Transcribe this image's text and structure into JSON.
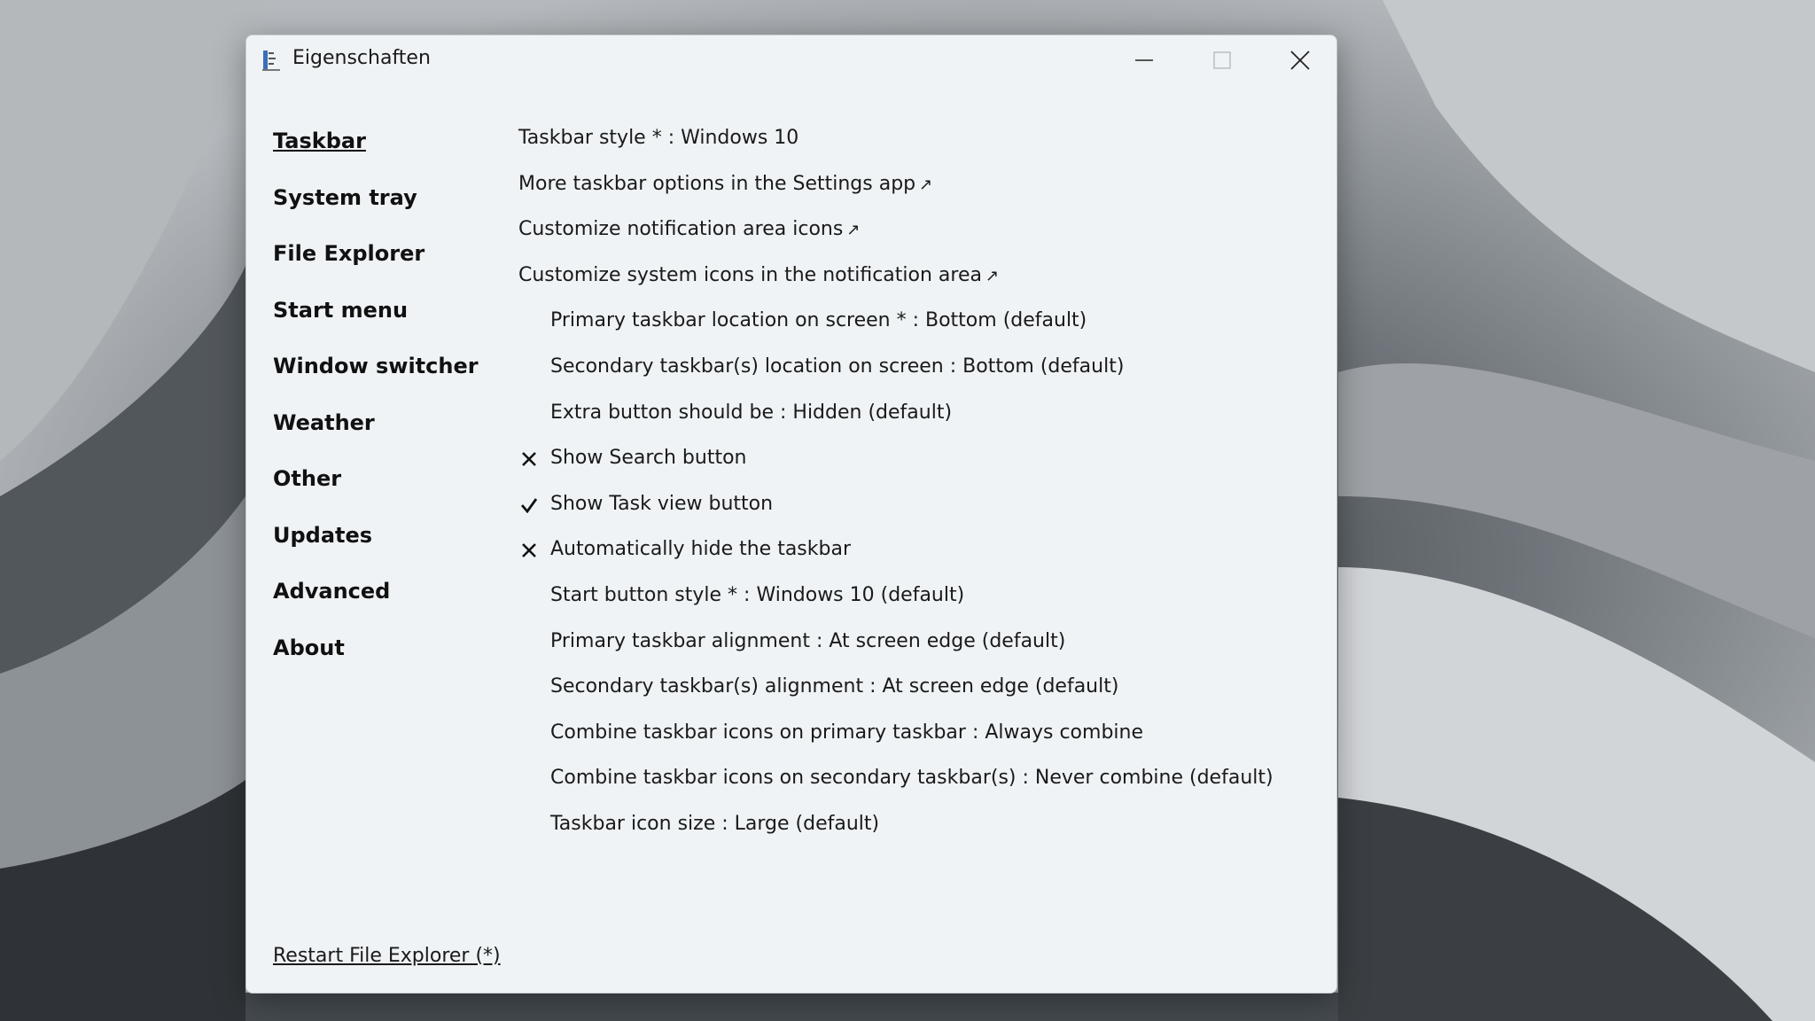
{
  "window": {
    "title": "Eigenschaften"
  },
  "sidebar": {
    "items": [
      {
        "label": "Taskbar",
        "active": true
      },
      {
        "label": "System tray"
      },
      {
        "label": "File Explorer"
      },
      {
        "label": "Start menu"
      },
      {
        "label": "Window switcher"
      },
      {
        "label": "Weather"
      },
      {
        "label": "Other"
      },
      {
        "label": "Updates"
      },
      {
        "label": "Advanced"
      },
      {
        "label": "About"
      }
    ]
  },
  "content": {
    "rows": [
      {
        "text": "Taskbar style * : Windows 10"
      },
      {
        "text": "More taskbar options in the Settings app",
        "arrow": "↗"
      },
      {
        "text": "Customize notification area icons",
        "arrow": "↗"
      },
      {
        "text": "Customize system icons in the notification area",
        "arrow": "↗"
      },
      {
        "text": "Primary taskbar location on screen * : Bottom (default)"
      },
      {
        "text": "Secondary taskbar(s) location on screen : Bottom (default)"
      },
      {
        "text": "Extra button should be : Hidden (default)"
      },
      {
        "text": "Show Search button",
        "checked": false
      },
      {
        "text": "Show Task view button",
        "checked": true
      },
      {
        "text": "Automatically hide the taskbar",
        "checked": false
      },
      {
        "text": "Start button style * : Windows 10 (default)"
      },
      {
        "text": "Primary taskbar alignment : At screen edge (default)"
      },
      {
        "text": "Secondary taskbar(s) alignment : At screen edge (default)"
      },
      {
        "text": "Combine taskbar icons on primary taskbar : Always combine"
      },
      {
        "text": "Combine taskbar icons on secondary taskbar(s) : Never combine (default)"
      },
      {
        "text": "Taskbar icon size : Large (default)"
      }
    ]
  },
  "footer": {
    "restart_label": "Restart File Explorer (*)"
  },
  "icons": {
    "app": "app-icon",
    "minimize": "minimize-icon",
    "maximize": "maximize-icon",
    "close": "close-icon",
    "check": "check-icon",
    "cross": "cross-icon"
  }
}
